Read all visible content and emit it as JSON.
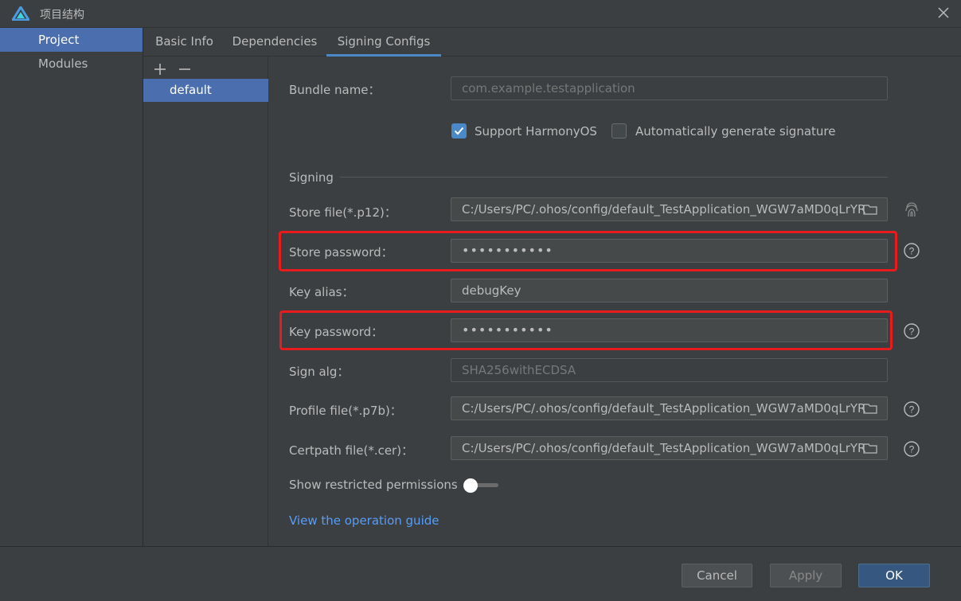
{
  "window": {
    "title": "项目结构"
  },
  "nav": {
    "items": [
      {
        "label": "Project",
        "selected": true
      },
      {
        "label": "Modules",
        "selected": false
      }
    ]
  },
  "tabs": [
    {
      "label": "Basic Info",
      "active": false
    },
    {
      "label": "Dependencies",
      "active": false
    },
    {
      "label": "Signing Configs",
      "active": true
    }
  ],
  "configs": {
    "add_icon": "plus-icon",
    "remove_icon": "minus-icon",
    "items": [
      {
        "label": "default",
        "selected": true
      }
    ]
  },
  "form": {
    "bundle_name": {
      "label": "Bundle name：",
      "value": "com.example.testapplication",
      "disabled": true
    },
    "support_harmonyos": {
      "label": "Support HarmonyOS",
      "checked": true
    },
    "auto_signature": {
      "label": "Automatically generate signature",
      "checked": false
    },
    "section_signing": "Signing",
    "store_file": {
      "label": "Store file(*.p12)：",
      "value": "C:/Users/PC/.ohos/config/default_TestApplication_WGW7aMD0qLrYR"
    },
    "store_password": {
      "label": "Store password：",
      "value": "•••••••••••"
    },
    "key_alias": {
      "label": "Key alias：",
      "value": "debugKey"
    },
    "key_password": {
      "label": "Key password：",
      "value": "•••••••••••"
    },
    "sign_alg": {
      "label": "Sign alg：",
      "value": "SHA256withECDSA",
      "disabled": true
    },
    "profile_file": {
      "label": "Profile file(*.p7b)：",
      "value": "C:/Users/PC/.ohos/config/default_TestApplication_WGW7aMD0qLrYR"
    },
    "certpath_file": {
      "label": "Certpath file(*.cer)：",
      "value": "C:/Users/PC/.ohos/config/default_TestApplication_WGW7aMD0qLrYR"
    },
    "restricted_permissions": {
      "label": "Show restricted permissions",
      "enabled": false
    },
    "guide_link": "View the operation guide"
  },
  "buttons": {
    "cancel": "Cancel",
    "apply": "Apply",
    "ok": "OK"
  },
  "colors": {
    "accent": "#4a88c7",
    "selection": "#4b6eaf",
    "highlight": "#e81c1c",
    "link": "#589df6"
  }
}
